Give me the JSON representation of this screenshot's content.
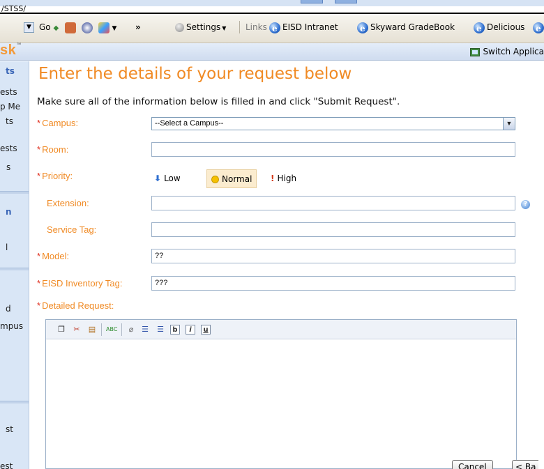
{
  "address": {
    "text": "/STSS/"
  },
  "toolbar": {
    "go_label": "Go",
    "chevron": "»",
    "settings_label": "Settings",
    "links_label": "Links",
    "links": [
      "EISD Intranet",
      "Skyward GradeBook",
      "Delicious"
    ]
  },
  "app": {
    "brand_fragment": "sk",
    "brand_tm": "™",
    "switch_label": "Switch Applica"
  },
  "sidebar": {
    "items": [
      "ts",
      "ests",
      "p Me",
      "ts",
      "ests",
      "s",
      "n",
      "l",
      "d",
      "mpus",
      "st",
      "est"
    ]
  },
  "form": {
    "title": "Enter the details of your request below",
    "instructions": "Make sure all of the information below is filled in and click \"Submit Request\".",
    "required_mark": "*",
    "labels": {
      "campus": "Campus:",
      "room": "Room:",
      "priority": "Priority:",
      "extension": "Extension:",
      "service_tag": "Service Tag:",
      "model": "Model:",
      "inventory_tag": "EISD Inventory Tag:",
      "detailed_request": "Detailed Request:"
    },
    "campus_select": {
      "selected": "--Select a Campus--"
    },
    "values": {
      "room": "",
      "extension": "",
      "service_tag": "",
      "model": "??",
      "inventory_tag": "???"
    },
    "priority": {
      "options": [
        "Low",
        "Normal",
        "High"
      ],
      "selected": "Normal"
    },
    "help_glyph": "?"
  },
  "editor_toolbar": {
    "bold": "b",
    "italic": "i",
    "underline": "u",
    "spell": "ABC"
  },
  "buttons": {
    "cancel": "Cancel",
    "back": "< Ba"
  },
  "colors": {
    "accent_orange": "#f08a24",
    "required_red": "#e03020",
    "sidebar_blue": "#d9e6f6"
  }
}
